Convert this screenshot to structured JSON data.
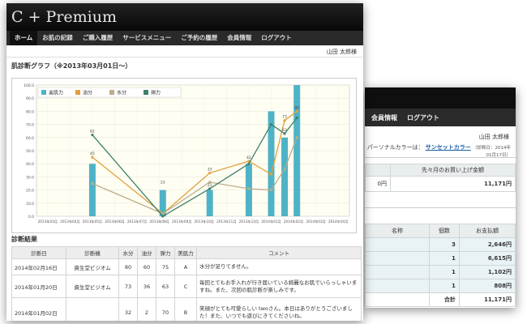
{
  "back_window": {
    "nav": [
      "会員情報",
      "ログアウト"
    ],
    "user": "山田 太郎様",
    "personal_color_label": "パーソナルカラーは：",
    "personal_color_value": "サンセットカラー",
    "personal_color_date": "（診断日：2014年01月17日）",
    "sales": {
      "header": "先々月のお買い上げ金額",
      "left_value": "0円",
      "right_value": "11,171円"
    },
    "items": {
      "headers": [
        "名称",
        "個数",
        "お支払額"
      ],
      "rows": [
        {
          "qty": "3",
          "amount": "2,646円"
        },
        {
          "qty": "1",
          "amount": "6,615円"
        },
        {
          "qty": "1",
          "amount": "1,102円"
        },
        {
          "qty": "1",
          "amount": "808円"
        }
      ],
      "total_label": "合計",
      "total_value": "11,171円"
    }
  },
  "front_window": {
    "brand": "C + Premium",
    "nav": [
      "ホーム",
      "お肌の記録",
      "ご購入履歴",
      "サービスメニュー",
      "ご予約の履歴",
      "会員情報",
      "ログアウト"
    ],
    "user": "山田 太郎様",
    "graph_title": "肌診断グラフ（※2013年03月01日〜）",
    "results_title": "診断結果",
    "results": {
      "headers": [
        "診断日",
        "診断機",
        "水分",
        "油分",
        "弾力",
        "美肌力",
        "コメント"
      ],
      "rows": [
        {
          "date": "2014年02月16日",
          "device": "資生堂ビジオム",
          "water": "80",
          "oil": "60",
          "elastic": "75",
          "beauty": "A",
          "comment": "水分が足りてません。"
        },
        {
          "date": "2014年01月20日",
          "device": "資生堂ビジオム",
          "water": "73",
          "oil": "36",
          "elastic": "63",
          "beauty": "C",
          "comment": "毎回とてもお手入れが行き届いている綺麗なお肌でいらっしゃいますね。また、次回の肌診断が楽しみです。"
        },
        {
          "date": "2014年01月02日",
          "device": "",
          "water": "32",
          "oil": "2",
          "elastic": "70",
          "beauty": "B",
          "comment": "笑顔がとても可愛らしい twoさん。本日はありがとうございました！また、いつでも遊びにきてくださいね。"
        }
      ]
    }
  },
  "chart_data": {
    "type": "bar",
    "title": "",
    "ylim": [
      0,
      100
    ],
    "yticks": [
      "0.0",
      "10.0",
      "20.0",
      "30.0",
      "40.0",
      "50.0",
      "60.0",
      "70.0",
      "80.0",
      "90.0",
      "100.0"
    ],
    "categories": [
      "2013年03月",
      "2013年04月",
      "2013年05月",
      "2013年06月",
      "2013年07月",
      "2013年08月",
      "2013年09月",
      "2013年10月",
      "2013年11月",
      "2013年12月",
      "2014年01月",
      "2014年02月",
      "2014年03月",
      "2014年04月"
    ],
    "x_positions": [
      0.5,
      1.5,
      2.5,
      3.5,
      4.5,
      5.5,
      6.5,
      7.5,
      8.5,
      9.5,
      10.5,
      11.5,
      12.5,
      13.5
    ],
    "legend": [
      "美肌力",
      "油分",
      "水分",
      "弾力"
    ],
    "colors": {
      "美肌力": "#4fb3c7",
      "油分": "#e0a040",
      "水分": "#b9ad8a",
      "弾力": "#3d7f6e"
    },
    "bars": [
      {
        "x": 2.5,
        "value": 40
      },
      {
        "x": 5.65,
        "value": 20
      },
      {
        "x": 7.75,
        "value": 20
      },
      {
        "x": 9.5,
        "value": 40
      },
      {
        "x": 10.5,
        "value": 80
      },
      {
        "x": 11.1,
        "value": 60
      },
      {
        "x": 11.65,
        "value": 100
      }
    ],
    "series": [
      {
        "name": "油分",
        "points": [
          [
            2.5,
            45
          ],
          [
            5.65,
            2
          ],
          [
            7.75,
            33
          ],
          [
            9.5,
            42
          ],
          [
            10.5,
            32
          ],
          [
            11.1,
            73
          ],
          [
            11.65,
            80
          ]
        ]
      },
      {
        "name": "水分",
        "points": [
          [
            2.5,
            25
          ],
          [
            5.65,
            2
          ],
          [
            7.75,
            26
          ],
          [
            9.5,
            21
          ],
          [
            10.5,
            20
          ],
          [
            11.1,
            36
          ],
          [
            11.65,
            60
          ]
        ]
      },
      {
        "name": "弾力",
        "points": [
          [
            2.5,
            62
          ],
          [
            5.65,
            0
          ],
          [
            7.75,
            21
          ],
          [
            9.5,
            40
          ],
          [
            10.5,
            70
          ],
          [
            11.1,
            63
          ],
          [
            11.65,
            75
          ]
        ]
      }
    ],
    "value_labels": [
      {
        "x": 2.5,
        "value": 62,
        "text": "62"
      },
      {
        "x": 2.5,
        "value": 45,
        "text": "45"
      },
      {
        "x": 5.65,
        "value": 23,
        "text": "23"
      },
      {
        "x": 7.75,
        "value": 33,
        "text": "33"
      },
      {
        "x": 7.75,
        "value": 21,
        "text": "21"
      },
      {
        "x": 9.5,
        "value": 42,
        "text": "42"
      },
      {
        "x": 11.1,
        "value": 73,
        "text": "73"
      },
      {
        "x": 11.1,
        "value": 63,
        "text": "63"
      },
      {
        "x": 11.65,
        "value": 80,
        "text": "80"
      }
    ]
  }
}
